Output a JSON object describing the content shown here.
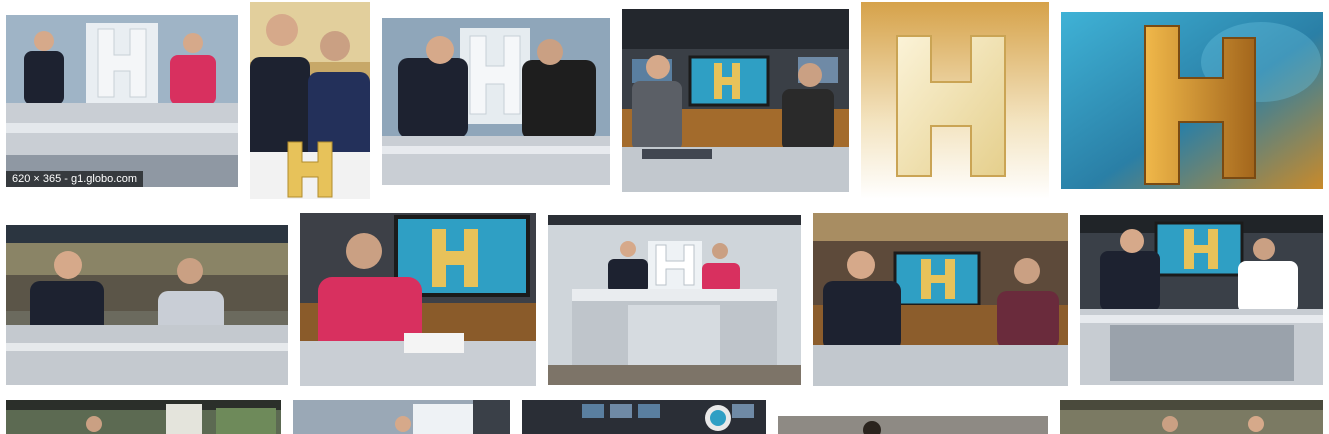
{
  "results": [
    {
      "caption": "620 × 365 - g1.globo.com"
    }
  ],
  "colors": {
    "studio_blue": "#6f8aa6",
    "desk_silver": "#c9ced4",
    "logo_gold": "#d9b64a",
    "suit_dark": "#1d2230",
    "pink_blouse": "#d8305f",
    "sky_teal": "#2f9fc4"
  }
}
